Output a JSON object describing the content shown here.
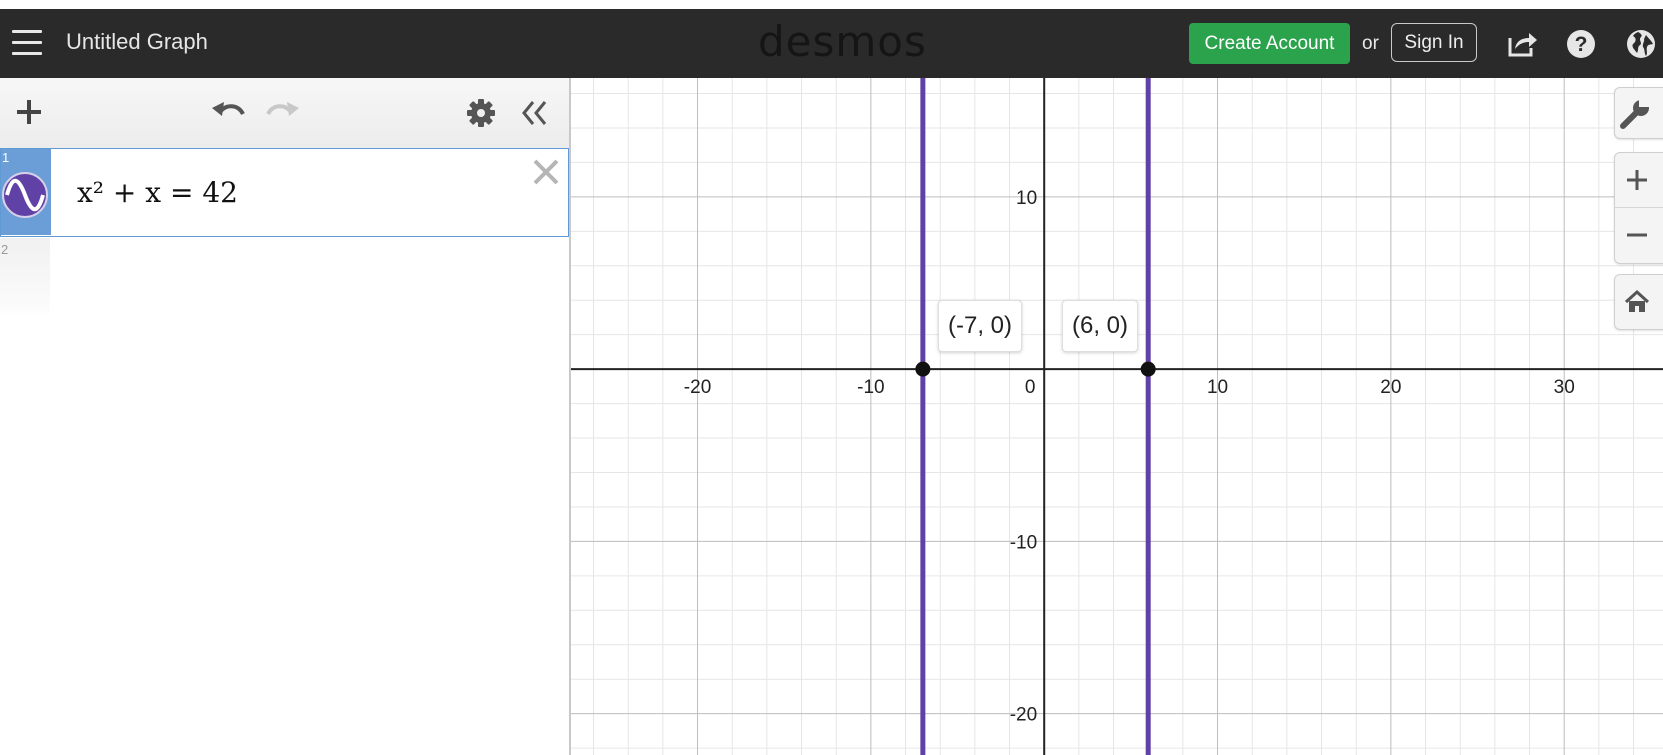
{
  "header": {
    "graph_title": "Untitled Graph",
    "logo": "desmos",
    "create_account": "Create Account",
    "or": "or",
    "sign_in": "Sign In",
    "icons": [
      "menu-icon",
      "share-icon",
      "help-icon",
      "globe-icon"
    ]
  },
  "expressions": [
    {
      "index": "1",
      "latex_display": "x² + x = 42",
      "color": "#6042a6"
    },
    {
      "index": "2",
      "latex_display": ""
    }
  ],
  "toolbar": {
    "icons": [
      "plus-icon",
      "undo-icon",
      "redo-icon",
      "gear-icon",
      "double-chevron-left-icon"
    ]
  },
  "graph": {
    "x_ticks": [
      "-20",
      "-10",
      "0",
      "10",
      "20",
      "30"
    ],
    "y_ticks": [
      "10",
      "-10",
      "-20"
    ],
    "points": [
      {
        "label": "(-7, 0)",
        "x": -7,
        "y": 0
      },
      {
        "label": "(6, 0)",
        "x": 6,
        "y": 0
      }
    ],
    "vertical_lines_x": [
      -7,
      6
    ],
    "line_color": "#6042a6",
    "x_range": [
      -27.3,
      35.7
    ],
    "y_range": [
      -22.4,
      16.9
    ]
  },
  "chart_data": {
    "type": "line",
    "title": "",
    "xlabel": "",
    "ylabel": "",
    "xlim": [
      -27.3,
      35.7
    ],
    "ylim": [
      -22.4,
      16.9
    ],
    "grid": true,
    "series": [
      {
        "name": "x² + x = 42",
        "x": [
          -7,
          -7
        ],
        "y": [
          -22.4,
          16.9
        ]
      },
      {
        "name": "x² + x = 42",
        "x": [
          6,
          6
        ],
        "y": [
          -22.4,
          16.9
        ]
      }
    ],
    "points": [
      {
        "x": -7,
        "y": 0
      },
      {
        "x": 6,
        "y": 0
      }
    ]
  },
  "side_controls": {
    "icons": [
      "wrench-icon",
      "zoom-in-icon",
      "zoom-out-icon",
      "home-icon"
    ]
  }
}
